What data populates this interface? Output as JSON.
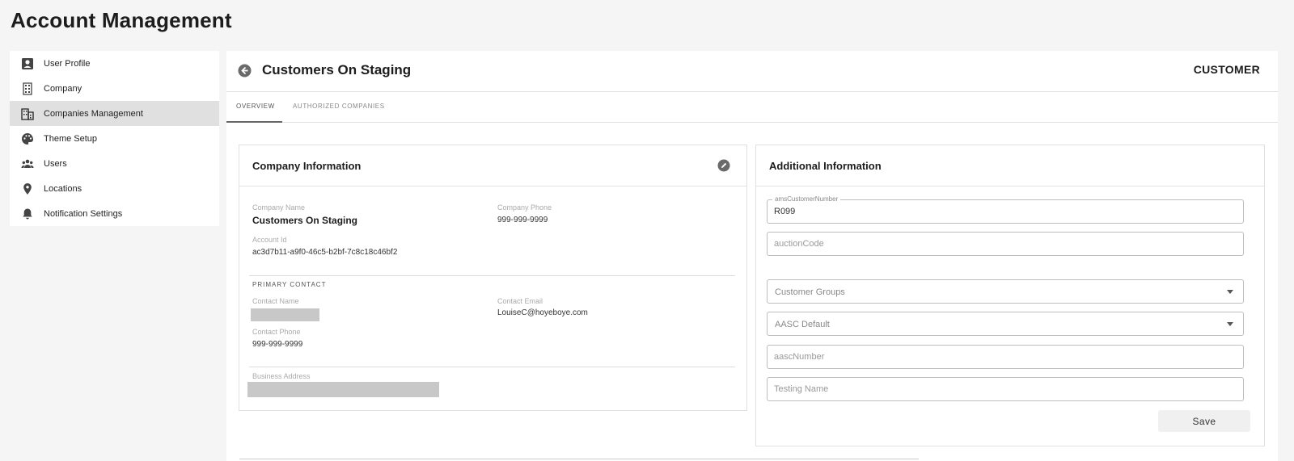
{
  "page": {
    "title": "Account Management"
  },
  "sidebar": {
    "items": [
      {
        "label": "User Profile",
        "icon": "user-profile-icon",
        "active": false
      },
      {
        "label": "Company",
        "icon": "building-icon",
        "active": false
      },
      {
        "label": "Companies Management",
        "icon": "companies-icon",
        "active": true
      },
      {
        "label": "Theme Setup",
        "icon": "palette-icon",
        "active": false
      },
      {
        "label": "Users",
        "icon": "users-icon",
        "active": false
      },
      {
        "label": "Locations",
        "icon": "location-pin-icon",
        "active": false
      },
      {
        "label": "Notification Settings",
        "icon": "bell-icon",
        "active": false
      }
    ]
  },
  "main": {
    "title": "Customers On Staging",
    "type_tag": "CUSTOMER",
    "tabs": [
      {
        "label": "OVERVIEW",
        "active": true
      },
      {
        "label": "AUTHORIZED COMPANIES",
        "active": false
      }
    ]
  },
  "company_info": {
    "title": "Company Information",
    "company_name_label": "Company Name",
    "company_name": "Customers On Staging",
    "company_phone_label": "Company Phone",
    "company_phone": "999-999-9999",
    "account_id_label": "Account Id",
    "account_id": "ac3d7b11-a9f0-46c5-b2bf-7c8c18c46bf2",
    "primary_contact_label": "PRIMARY CONTACT",
    "contact_name_label": "Contact Name",
    "contact_email_label": "Contact Email",
    "contact_email": "LouiseC@hoyeboye.com",
    "contact_phone_label": "Contact Phone",
    "contact_phone": "999-999-9999",
    "business_address_label": "Business Address"
  },
  "additional_info": {
    "title": "Additional Information",
    "ams_label": "amsCustomerNumber",
    "ams_value": "R099",
    "auction_placeholder": "auctionCode",
    "customer_groups_placeholder": "Customer Groups",
    "aasc_default_placeholder": "AASC Default",
    "aasc_number_placeholder": "aascNumber",
    "testing_name_placeholder": "Testing Name",
    "save_label": "Save"
  },
  "colors": {
    "active_bg": "#e0e0e0",
    "accent": "#666666"
  }
}
